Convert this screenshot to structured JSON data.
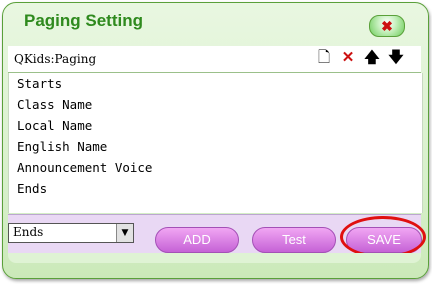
{
  "window": {
    "title": "Paging Setting",
    "close_glyph": "✖"
  },
  "pathbar": {
    "label": "QKids:Paging",
    "tools": [
      {
        "icon": "new-page-icon",
        "glyph": "🗋"
      },
      {
        "icon": "delete-icon",
        "glyph": "✕",
        "color": "#cc1111"
      },
      {
        "icon": "move-up-icon",
        "glyph": "🡅"
      },
      {
        "icon": "move-down-icon",
        "glyph": "🡇"
      }
    ]
  },
  "list": {
    "items": [
      "Starts",
      "Class Name",
      "Local Name",
      "English Name",
      "Announcement Voice",
      "Ends"
    ]
  },
  "controls": {
    "select_value": "Ends",
    "select_arrow": "▼",
    "add_label": "ADD",
    "test_label": "Test",
    "save_label": "SAVE"
  },
  "colors": {
    "title": "#2f8a1e",
    "button": "#d27ddf",
    "highlight": "#e01010"
  }
}
